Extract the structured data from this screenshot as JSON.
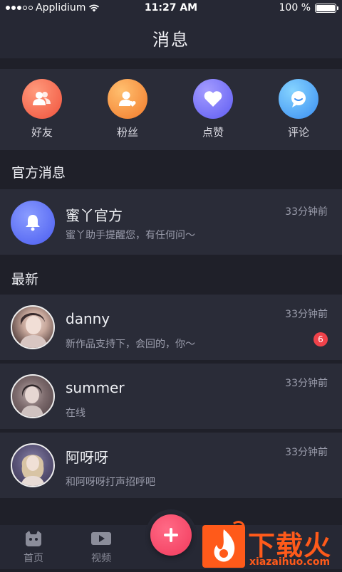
{
  "status_bar": {
    "carrier": "Applidium",
    "time": "11:27 AM",
    "battery_text": "100 %",
    "battery_level": 1.0
  },
  "nav": {
    "title": "消息"
  },
  "categories": [
    {
      "label": "好友",
      "icon": "friends-icon",
      "color_from": "#ff8a6e",
      "color_to": "#f0523c"
    },
    {
      "label": "粉丝",
      "icon": "fans-icon",
      "color_from": "#ffb35c",
      "color_to": "#f27a2a"
    },
    {
      "label": "点赞",
      "icon": "heart-icon",
      "color_from": "#8f86ff",
      "color_to": "#5e5cf2"
    },
    {
      "label": "评论",
      "icon": "comment-icon",
      "color_from": "#6cc8ff",
      "color_to": "#3a8ef2"
    }
  ],
  "official_section": {
    "header": "官方消息",
    "item": {
      "name": "蜜丫官方",
      "message": "蜜丫助手提醒您，有任何问～",
      "time": "33分钟前"
    }
  },
  "latest_section": {
    "header": "最新",
    "items": [
      {
        "name": "danny",
        "message": "新作品支持下，会回的，你～",
        "time": "33分钟前",
        "badge": "6"
      },
      {
        "name": "summer",
        "message": "在线",
        "time": "33分钟前"
      },
      {
        "name": "阿呀呀",
        "message": "和阿呀呀打声招呼吧",
        "time": "33分钟前"
      }
    ]
  },
  "tab_bar": {
    "tabs": [
      {
        "label": "首页",
        "icon": "home-icon"
      },
      {
        "label": "视频",
        "icon": "video-icon"
      }
    ],
    "fab_icon": "plus-icon"
  },
  "watermark": {
    "title": "下载火",
    "url": "xiazaihuo.com"
  },
  "colors": {
    "background": "#1f2029",
    "card": "#2a2c38",
    "bar": "#262834",
    "accent": "#f23a5c",
    "badge": "#f0424a"
  }
}
